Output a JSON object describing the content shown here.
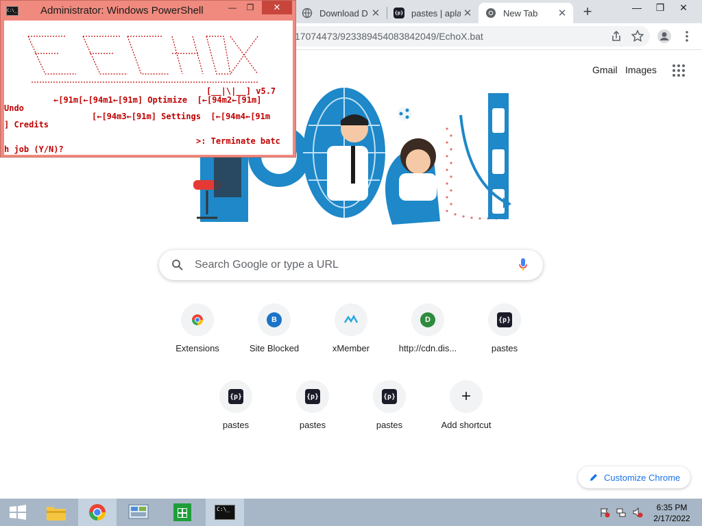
{
  "chrome": {
    "tabs": [
      {
        "title": "Download D"
      },
      {
        "title": "pastes | aplas"
      },
      {
        "title": "New Tab"
      }
    ],
    "new_tab_symbol": "+",
    "url": "17074473/923389454083842049/EchoX.bat",
    "controls": {
      "minimize": "—",
      "maximize": "❐",
      "close": "✕"
    }
  },
  "ntp": {
    "gmail": "Gmail",
    "images": "Images",
    "search_placeholder": "Search Google or type a URL",
    "shortcuts": [
      {
        "label": "Extensions",
        "icon": "chrome-icon"
      },
      {
        "label": "Site Blocked",
        "icon": "B"
      },
      {
        "label": "xMember",
        "icon": "xmember-icon"
      },
      {
        "label": "http://cdn.dis...",
        "icon": "D"
      },
      {
        "label": "pastes",
        "icon": "{p}"
      },
      {
        "label": "pastes",
        "icon": "{p}"
      },
      {
        "label": "pastes",
        "icon": "{p}"
      },
      {
        "label": "pastes",
        "icon": "{p}"
      },
      {
        "label": "Add shortcut",
        "icon": "+"
      }
    ],
    "customize": "Customize Chrome"
  },
  "powershell": {
    "title": "Administrator: Windows PowerShell",
    "icon_text": "C:\\_",
    "version": "[__|\\|__] v5.7",
    "lines": [
      "←[91m[←[94m1←[91m] Optimize  [←[94m2←[91m]",
      "Undo",
      "[←[94m3←[91m] Settings  [←[94m4←[91m",
      "] Credits",
      ">: Terminate batc",
      "h job (Y/N)?"
    ]
  },
  "taskbar": {
    "time": "6:35 PM",
    "date": "2/17/2022",
    "cmd_text": "C:\\_"
  },
  "colors": {
    "accent": "#1a73e8",
    "ps_title_bg": "#f08a7e",
    "ps_text": "#c00000",
    "taskbar": "#a8b7c7"
  }
}
